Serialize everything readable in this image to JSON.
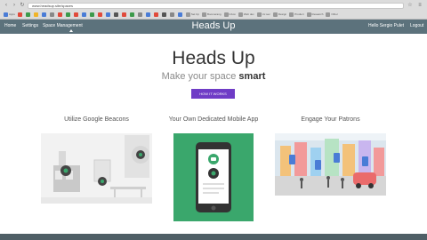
{
  "browser": {
    "url": "www.headsup.site/spaces",
    "bookmarks": [
      {
        "label": "Apps",
        "color": "#4a7cd6"
      },
      {
        "label": "",
        "color": "#e04a3b"
      },
      {
        "label": "",
        "color": "#3c9a4b"
      },
      {
        "label": "",
        "color": "#f0b429"
      },
      {
        "label": "",
        "color": "#4a7cd6"
      },
      {
        "label": "",
        "color": "#888888"
      },
      {
        "label": "",
        "color": "#e04a3b"
      },
      {
        "label": "",
        "color": "#3c9a4b"
      },
      {
        "label": "",
        "color": "#e04a3b"
      },
      {
        "label": "",
        "color": "#4a7cd6"
      },
      {
        "label": "",
        "color": "#3c9a4b"
      },
      {
        "label": "",
        "color": "#e04a3b"
      },
      {
        "label": "",
        "color": "#4a7cd6"
      },
      {
        "label": "",
        "color": "#555555"
      },
      {
        "label": "",
        "color": "#e04a3b"
      },
      {
        "label": "",
        "color": "#3c9a4b"
      },
      {
        "label": "",
        "color": "#888888"
      },
      {
        "label": "",
        "color": "#4a7cd6"
      },
      {
        "label": "",
        "color": "#e04a3b"
      },
      {
        "label": "",
        "color": "#555555"
      },
      {
        "label": "",
        "color": "#888888"
      },
      {
        "label": "",
        "color": "#4a7cd6"
      },
      {
        "label": "Set Up",
        "color": "#999999"
      },
      {
        "label": "Boomerang",
        "color": "#999999"
      },
      {
        "label": "Inbox",
        "color": "#999999"
      },
      {
        "label": "Web dev",
        "color": "#999999"
      },
      {
        "label": "Ux sec",
        "color": "#999999"
      },
      {
        "label": "Design",
        "color": "#999999"
      },
      {
        "label": "Product",
        "color": "#999999"
      },
      {
        "label": "Research",
        "color": "#999999"
      },
      {
        "label": "Other",
        "color": "#999999"
      }
    ]
  },
  "nav": {
    "home": "Home",
    "settings": "Settings",
    "space_management": "Space Management",
    "brand": "Heads Up",
    "greeting": "Hello Sergio Pulet",
    "logout": "Logout"
  },
  "hero": {
    "title": "Heads Up",
    "tagline_prefix": "Make your space ",
    "tagline_bold": "smart",
    "cta": "HOW IT WORKS"
  },
  "features": [
    {
      "title": "Utilize Google Beacons"
    },
    {
      "title": "Your Own Dedicated Mobile App"
    },
    {
      "title": "Engage Your Patrons"
    }
  ],
  "colors": {
    "nav_bg": "#5c727c",
    "cta_bg": "#6f3cc6",
    "mobile_panel_bg": "#3aa76c"
  }
}
